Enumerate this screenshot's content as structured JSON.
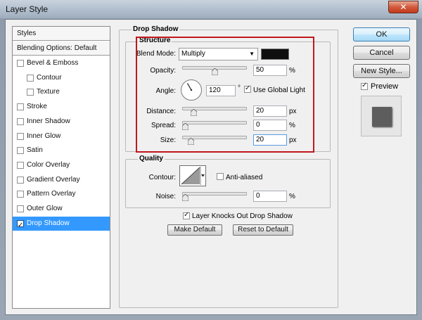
{
  "window": {
    "title": "Layer Style",
    "close_glyph": "✕"
  },
  "styles_list": {
    "header": "Styles",
    "blending": "Blending Options: Default",
    "items": [
      {
        "label": "Bevel & Emboss",
        "checked": false,
        "indent": false
      },
      {
        "label": "Contour",
        "checked": false,
        "indent": true
      },
      {
        "label": "Texture",
        "checked": false,
        "indent": true
      },
      {
        "label": "Stroke",
        "checked": false,
        "indent": false
      },
      {
        "label": "Inner Shadow",
        "checked": false,
        "indent": false
      },
      {
        "label": "Inner Glow",
        "checked": false,
        "indent": false
      },
      {
        "label": "Satin",
        "checked": false,
        "indent": false
      },
      {
        "label": "Color Overlay",
        "checked": false,
        "indent": false
      },
      {
        "label": "Gradient Overlay",
        "checked": false,
        "indent": false
      },
      {
        "label": "Pattern Overlay",
        "checked": false,
        "indent": false
      },
      {
        "label": "Outer Glow",
        "checked": false,
        "indent": false
      },
      {
        "label": "Drop Shadow",
        "checked": true,
        "indent": false,
        "selected": true
      }
    ]
  },
  "drop_shadow": {
    "title": "Drop Shadow",
    "structure": {
      "title": "Structure",
      "blend_mode_label": "Blend Mode:",
      "blend_mode_value": "Multiply",
      "shadow_color": "#0f0f10",
      "opacity_label": "Opacity:",
      "opacity_value": "50",
      "opacity_unit": "%",
      "opacity_fraction": 0.5,
      "angle_label": "Angle:",
      "angle_value": "120",
      "angle_unit": "°",
      "angle_degrees": 120,
      "use_global_light_label": "Use Global Light",
      "use_global_light": true,
      "distance_label": "Distance:",
      "distance_value": "20",
      "distance_unit": "px",
      "distance_fraction": 0.15,
      "spread_label": "Spread:",
      "spread_value": "0",
      "spread_unit": "%",
      "spread_fraction": 0.0,
      "size_label": "Size:",
      "size_value": "20",
      "size_unit": "px",
      "size_fraction": 0.1
    },
    "quality": {
      "title": "Quality",
      "contour_label": "Contour:",
      "anti_aliased_label": "Anti-aliased",
      "anti_aliased": false,
      "noise_label": "Noise:",
      "noise_value": "0",
      "noise_unit": "%",
      "noise_fraction": 0.0
    },
    "knocks_out_label": "Layer Knocks Out Drop Shadow",
    "knocks_out": true,
    "make_default_label": "Make Default",
    "reset_default_label": "Reset to Default"
  },
  "buttons": {
    "ok": "OK",
    "cancel": "Cancel",
    "new_style": "New Style...",
    "preview_label": "Preview",
    "preview_checked": true
  },
  "colors": {
    "highlight_outline": "#c1171e",
    "selection": "#3399ff"
  },
  "icons": {
    "checkbox": "checkbox-icon",
    "dropdown": "chevron-down-icon",
    "angle_dial": "angle-dial-icon",
    "slider": "slider-thumb-icon",
    "contour": "contour-curve-icon",
    "close": "close-icon"
  }
}
